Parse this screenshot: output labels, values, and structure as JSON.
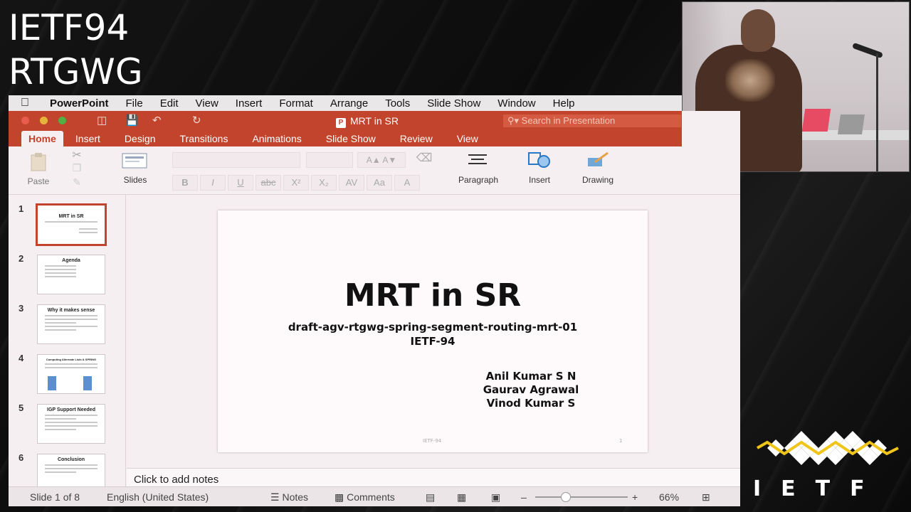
{
  "overlay": {
    "line1": "IETF94",
    "line2": "RTGWG"
  },
  "menubar": {
    "apple_icon": "apple-icon",
    "items": [
      "PowerPoint",
      "File",
      "Edit",
      "View",
      "Insert",
      "Format",
      "Arrange",
      "Tools",
      "Slide Show",
      "Window",
      "Help"
    ]
  },
  "window": {
    "doc_title": "MRT in SR",
    "search_placeholder": "Search in Presentation",
    "tabs": [
      "Home",
      "Insert",
      "Design",
      "Transitions",
      "Animations",
      "Slide Show",
      "Review",
      "View"
    ],
    "accent_color": "#c2442c"
  },
  "ribbon": {
    "paste_label": "Paste",
    "slides_label": "Slides",
    "paragraph_label": "Paragraph",
    "insert_label": "Insert",
    "drawing_label": "Drawing",
    "format_buttons": [
      "B",
      "I",
      "U",
      "abc",
      "X²",
      "X₂",
      "AV",
      "Aa",
      "A"
    ],
    "font_size_buttons": "A▲ A▼"
  },
  "thumbnails": [
    {
      "number": "1",
      "title": "MRT in SR",
      "selected": true
    },
    {
      "number": "2",
      "title": "Agenda"
    },
    {
      "number": "3",
      "title": "Why it makes sense"
    },
    {
      "number": "4",
      "title": "Computing Alternate Lists & SPRING"
    },
    {
      "number": "5",
      "title": "IGP Support Needed"
    },
    {
      "number": "6",
      "title": "Conclusion"
    }
  ],
  "slide": {
    "title": "MRT in SR",
    "subtitle": "draft-agv-rtgwg-spring-segment-routing-mrt-01",
    "event": "IETF-94",
    "authors": [
      "Anil Kumar S N",
      "Gaurav Agrawal",
      "Vinod Kumar S"
    ],
    "footer": "IETF-94",
    "page_number": "1"
  },
  "notes": {
    "placeholder": "Click to add notes"
  },
  "statusbar": {
    "slide_counter": "Slide 1 of 8",
    "language": "English (United States)",
    "notes_label": "Notes",
    "comments_label": "Comments",
    "zoom_minus": "–",
    "zoom_plus": "+",
    "zoom_level": "66%"
  },
  "logo": {
    "text": "IETF"
  }
}
